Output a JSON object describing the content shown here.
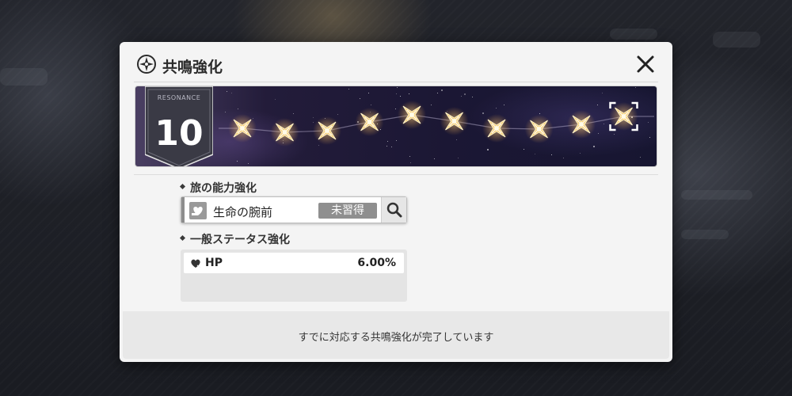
{
  "dialog": {
    "title": "共鳴強化",
    "icon": "compass-star-icon",
    "close_icon": "close-icon"
  },
  "resonance": {
    "badge_label": "RESONANCE",
    "level": "10",
    "nodes_total": 10,
    "nodes_active": 10,
    "node_icon": "star-node-icon",
    "selected_node": 10
  },
  "travel_ability": {
    "section_title": "旅の能力強化",
    "name": "生命の腕前",
    "status": "未習得",
    "icon": "heart-hand-icon",
    "search_icon": "magnifier-icon"
  },
  "general_stats": {
    "section_title": "一般ステータス強化",
    "items": [
      {
        "name": "HP",
        "value": "6.00%",
        "icon": "heart-icon"
      }
    ]
  },
  "footer": {
    "message": "すでに対応する共鳴強化が完了しています"
  },
  "colors": {
    "accent_gold": "#f2c46a",
    "status_gray": "#8f8f8f",
    "dialog_bg": "#f4f4f4"
  }
}
